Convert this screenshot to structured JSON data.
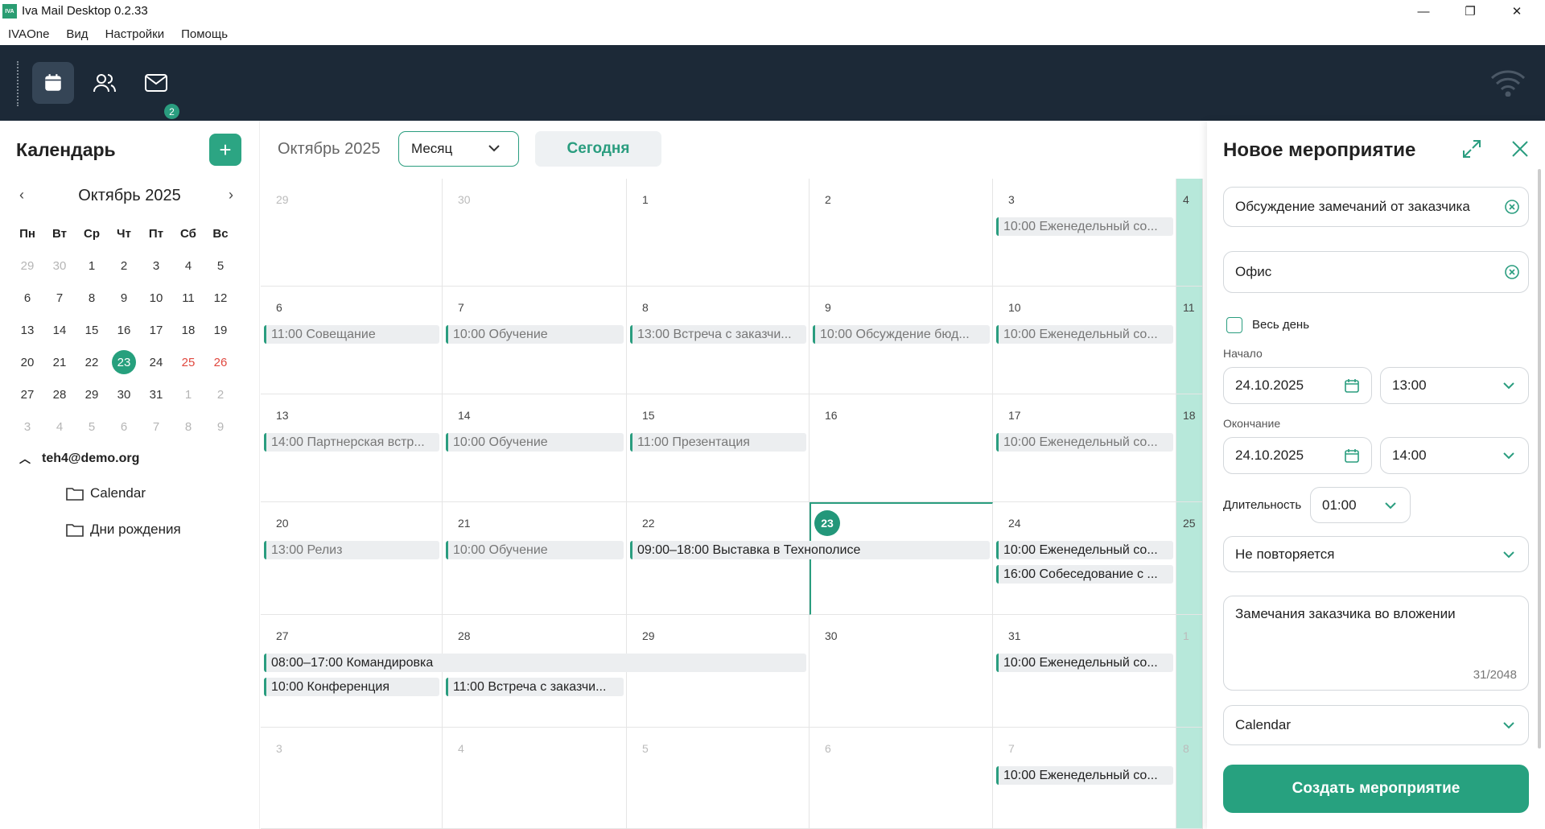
{
  "window": {
    "title": "Iva Mail Desktop 0.2.33",
    "logo_text": "IVA",
    "minimize": "—",
    "maximize": "❐",
    "close": "✕"
  },
  "menu": [
    "IVAOne",
    "Вид",
    "Настройки",
    "Помощь"
  ],
  "nav": {
    "mail_badge": "2"
  },
  "sidebar": {
    "title": "Календарь",
    "add": "+",
    "mini": {
      "month": "Октябрь 2025",
      "weekdays": [
        "Пн",
        "Вт",
        "Ср",
        "Чт",
        "Пт",
        "Сб",
        "Вс"
      ],
      "weeks": [
        [
          "29",
          "30",
          "1",
          "2",
          "3",
          "4",
          "5"
        ],
        [
          "6",
          "7",
          "8",
          "9",
          "10",
          "11",
          "12"
        ],
        [
          "13",
          "14",
          "15",
          "16",
          "17",
          "18",
          "19"
        ],
        [
          "20",
          "21",
          "22",
          "23",
          "24",
          "25",
          "26"
        ],
        [
          "27",
          "28",
          "29",
          "30",
          "31",
          "1",
          "2"
        ],
        [
          "3",
          "4",
          "5",
          "6",
          "7",
          "8",
          "9"
        ]
      ],
      "today": "23"
    },
    "account": "teh4@demo.org",
    "folders": [
      "Calendar",
      "Дни рождения"
    ]
  },
  "toolbar": {
    "month_title": "Октябрь 2025",
    "view": "Месяц",
    "today": "Сегодня"
  },
  "month": {
    "rows": [
      {
        "days": [
          "29",
          "30",
          "1",
          "2",
          "3",
          "4"
        ],
        "dim": [
          true,
          true,
          false,
          false,
          false,
          false
        ]
      },
      {
        "days": [
          "6",
          "7",
          "8",
          "9",
          "10",
          "11"
        ],
        "dim": [
          false,
          false,
          false,
          false,
          false,
          false
        ]
      },
      {
        "days": [
          "13",
          "14",
          "15",
          "16",
          "17",
          "18"
        ],
        "dim": [
          false,
          false,
          false,
          false,
          false,
          false
        ]
      },
      {
        "days": [
          "20",
          "21",
          "22",
          "23",
          "24",
          "25"
        ],
        "dim": [
          false,
          false,
          false,
          false,
          false,
          false
        ]
      },
      {
        "days": [
          "27",
          "28",
          "29",
          "30",
          "31",
          "1"
        ],
        "dim": [
          false,
          false,
          false,
          false,
          false,
          true
        ]
      },
      {
        "days": [
          "3",
          "4",
          "5",
          "6",
          "7",
          "8"
        ],
        "dim": [
          true,
          true,
          true,
          true,
          true,
          true
        ]
      }
    ],
    "events": [
      {
        "row": 0,
        "col": 4,
        "slot": 0,
        "span": 1,
        "time": "10:00",
        "title": "Еженедельный со...",
        "active": false
      },
      {
        "row": 1,
        "col": 0,
        "slot": 0,
        "span": 1,
        "time": "11:00",
        "title": "Совещание",
        "active": false
      },
      {
        "row": 1,
        "col": 1,
        "slot": 0,
        "span": 1,
        "time": "10:00",
        "title": "Обучение",
        "active": false
      },
      {
        "row": 1,
        "col": 2,
        "slot": 0,
        "span": 1,
        "time": "13:00",
        "title": "Встреча с заказчи...",
        "active": false
      },
      {
        "row": 1,
        "col": 3,
        "slot": 0,
        "span": 1,
        "time": "10:00",
        "title": "Обсуждение бюд...",
        "active": false
      },
      {
        "row": 1,
        "col": 4,
        "slot": 0,
        "span": 1,
        "time": "10:00",
        "title": "Еженедельный со...",
        "active": false
      },
      {
        "row": 2,
        "col": 0,
        "slot": 0,
        "span": 1,
        "time": "14:00",
        "title": "Партнерская встр...",
        "active": false
      },
      {
        "row": 2,
        "col": 1,
        "slot": 0,
        "span": 1,
        "time": "10:00",
        "title": "Обучение",
        "active": false
      },
      {
        "row": 2,
        "col": 2,
        "slot": 0,
        "span": 1,
        "time": "11:00",
        "title": "Презентация",
        "active": false
      },
      {
        "row": 2,
        "col": 4,
        "slot": 0,
        "span": 1,
        "time": "10:00",
        "title": "Еженедельный со...",
        "active": false
      },
      {
        "row": 3,
        "col": 0,
        "slot": 0,
        "span": 1,
        "time": "13:00",
        "title": "Релиз",
        "active": false
      },
      {
        "row": 3,
        "col": 1,
        "slot": 0,
        "span": 1,
        "time": "10:00",
        "title": "Обучение",
        "active": false
      },
      {
        "row": 3,
        "col": 2,
        "slot": 0,
        "span": 2,
        "time": "09:00–18:00",
        "title": "Выставка в Технополисе",
        "active": true
      },
      {
        "row": 3,
        "col": 4,
        "slot": 0,
        "span": 1,
        "time": "10:00",
        "title": "Еженедельный со...",
        "active": true
      },
      {
        "row": 3,
        "col": 4,
        "slot": 1,
        "span": 1,
        "time": "16:00",
        "title": "Собеседование с ...",
        "active": true
      },
      {
        "row": 4,
        "col": 0,
        "slot": 0,
        "span": 3,
        "time": "08:00–17:00",
        "title": "Командировка",
        "active": true
      },
      {
        "row": 4,
        "col": 0,
        "slot": 1,
        "span": 1,
        "time": "10:00",
        "title": "Конференция",
        "active": true
      },
      {
        "row": 4,
        "col": 1,
        "slot": 1,
        "span": 1,
        "time": "11:00",
        "title": "Встреча с заказчи...",
        "active": true
      },
      {
        "row": 4,
        "col": 4,
        "slot": 0,
        "span": 1,
        "time": "10:00",
        "title": "Еженедельный со...",
        "active": true
      },
      {
        "row": 5,
        "col": 4,
        "slot": 0,
        "span": 1,
        "time": "10:00",
        "title": "Еженедельный со...",
        "active": true
      }
    ]
  },
  "panel": {
    "title": "Новое мероприятие",
    "subject": "Обсуждение замечаний от заказчика",
    "location": "Офис",
    "all_day": "Весь день",
    "start_label": "Начало",
    "start_date": "24.10.2025",
    "start_time": "13:00",
    "end_label": "Окончание",
    "end_date": "24.10.2025",
    "end_time": "14:00",
    "duration_label": "Длительность",
    "duration": "01:00",
    "repeat": "Не повторяется",
    "description": "Замечания заказчика во вложении",
    "counter": "31/2048",
    "calendar": "Calendar",
    "create": "Создать мероприятие"
  },
  "colors": {
    "accent": "#2a9d7f",
    "nav_bg": "#1c2937",
    "weekend": "#e0483f",
    "weekend_col": "#b7e8da"
  }
}
